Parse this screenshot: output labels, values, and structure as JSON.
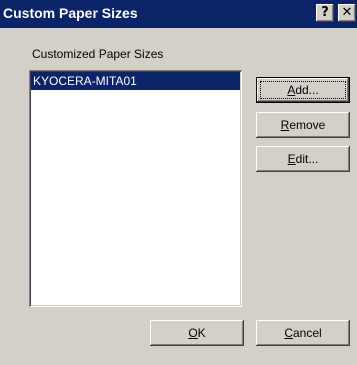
{
  "window": {
    "title": "Custom Paper Sizes",
    "help_glyph": "?",
    "close_glyph": "✕"
  },
  "list": {
    "label": "Customized Paper Sizes",
    "items": [
      {
        "name": "KYOCERA-MITA01",
        "selected": true
      }
    ]
  },
  "buttons": {
    "add": {
      "accel": "A",
      "rest": "dd..."
    },
    "remove": {
      "accel": "R",
      "rest": "emove"
    },
    "edit": {
      "accel": "E",
      "rest": "dit..."
    },
    "ok": {
      "accel": "O",
      "rest": "K"
    },
    "cancel": {
      "accel": "C",
      "rest": "ancel"
    }
  },
  "colors": {
    "titlebar": "#0a246a",
    "face": "#d4d0c8",
    "selection": "#0a246a"
  }
}
